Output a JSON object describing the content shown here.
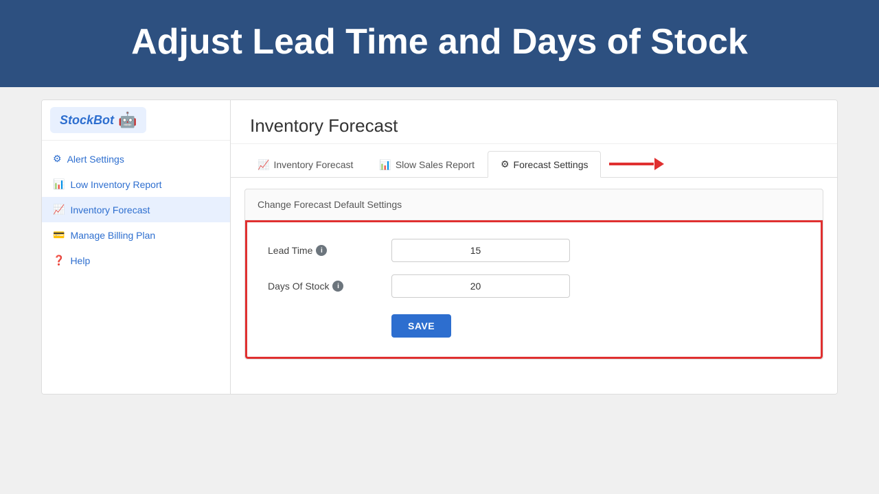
{
  "hero": {
    "title": "Adjust Lead Time and Days of Stock"
  },
  "sidebar": {
    "logo": {
      "text": "StockBot",
      "icon": "🤖"
    },
    "nav_items": [
      {
        "id": "alert-settings",
        "icon": "⚙",
        "label": "Alert Settings",
        "active": false
      },
      {
        "id": "low-inventory-report",
        "icon": "📊",
        "label": "Low Inventory Report",
        "active": false
      },
      {
        "id": "inventory-forecast",
        "icon": "📈",
        "label": "Inventory Forecast",
        "active": true
      },
      {
        "id": "manage-billing-plan",
        "icon": "💳",
        "label": "Manage Billing Plan",
        "active": false
      },
      {
        "id": "help",
        "icon": "❓",
        "label": "Help",
        "active": false
      }
    ]
  },
  "main": {
    "page_title": "Inventory Forecast",
    "tabs": [
      {
        "id": "inventory-forecast-tab",
        "icon": "📈",
        "label": "Inventory Forecast",
        "active": false
      },
      {
        "id": "slow-sales-report-tab",
        "icon": "📊",
        "label": "Slow Sales Report",
        "active": false
      },
      {
        "id": "forecast-settings-tab",
        "icon": "⚙",
        "label": "Forecast Settings",
        "active": true
      }
    ],
    "settings_section": {
      "section_title": "Change Forecast Default Settings",
      "fields": [
        {
          "id": "lead-time",
          "label": "Lead Time",
          "value": "15",
          "has_info": true
        },
        {
          "id": "days-of-stock",
          "label": "Days Of Stock",
          "value": "20",
          "has_info": true
        }
      ],
      "save_button_label": "SAVE"
    }
  },
  "colors": {
    "hero_bg": "#2d5080",
    "accent_blue": "#2d6ecf",
    "arrow_red": "#e03030",
    "border_red": "#e03030"
  }
}
